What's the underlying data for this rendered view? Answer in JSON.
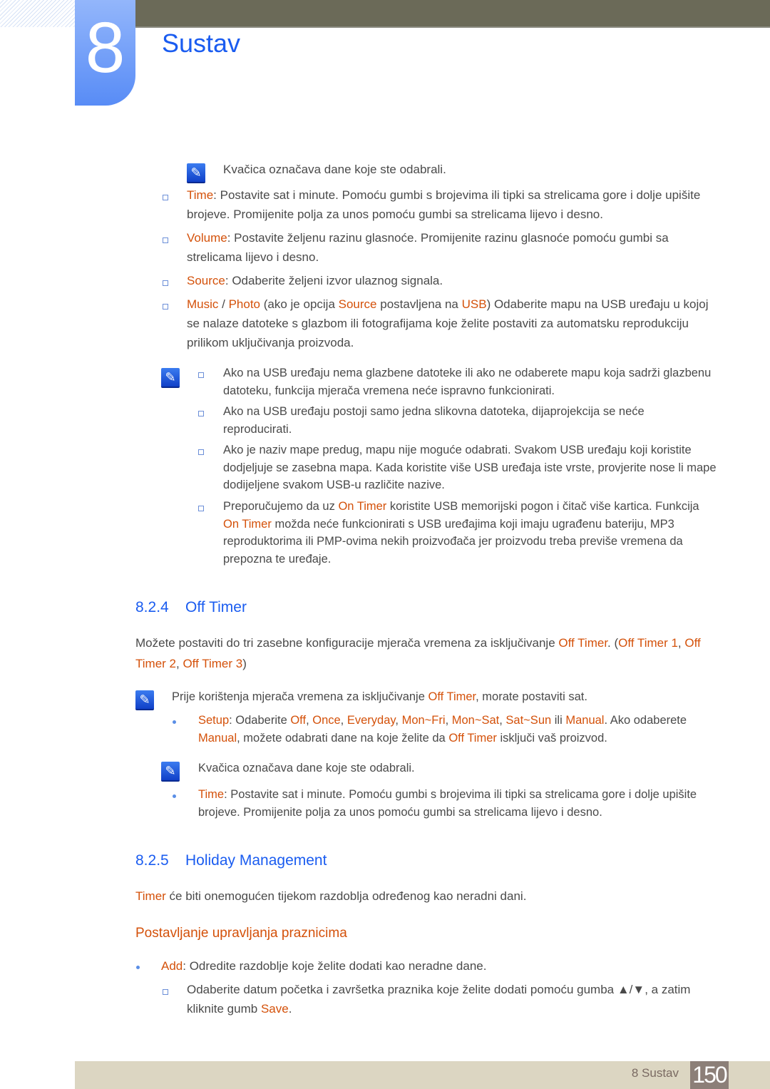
{
  "header": {
    "chapter_number": "8",
    "chapter_title": "Sustav"
  },
  "blocks": [
    {
      "parts": [
        [
          "Kvačica označava dane koje ste odabrali.",
          0
        ]
      ]
    },
    {
      "parts": [
        [
          "Time",
          1
        ],
        [
          ": Postavite sat i minute. Pomoću gumbi s brojevima ili tipki sa strelicama gore i dolje upišite brojeve. Promijenite polja za unos pomoću gumbi sa strelicama lijevo i desno.",
          0
        ]
      ]
    },
    {
      "parts": [
        [
          "Volume",
          1
        ],
        [
          ": Postavite željenu razinu glasnoće. Promijenite razinu glasnoće pomoću gumbi sa strelicama lijevo i desno.",
          0
        ]
      ]
    },
    {
      "parts": [
        [
          "Source",
          1
        ],
        [
          ": Odaberite željeni izvor ulaznog signala.",
          0
        ]
      ]
    },
    {
      "parts": [
        [
          "Music",
          1
        ],
        [
          " / ",
          0
        ],
        [
          "Photo",
          1
        ],
        [
          " (ako je opcija ",
          0
        ],
        [
          "Source",
          1
        ],
        [
          " postavljena na ",
          0
        ],
        [
          "USB",
          1
        ],
        [
          ") Odaberite mapu na USB uređaju u kojoj se nalaze datoteke s glazbom ili fotografijama koje želite postaviti za automatsku reprodukciju prilikom uključivanja proizvoda.",
          0
        ]
      ]
    },
    {
      "parts": [
        [
          "Ako na USB uređaju nema glazbene datoteke ili ako ne odaberete mapu koja sadrži glazbenu datoteku, funkcija mjerača vremena neće ispravno funkcionirati.",
          0
        ]
      ]
    },
    {
      "parts": [
        [
          "Ako na USB uređaju postoji samo jedna slikovna datoteka, dijaprojekcija se neće reproducirati.",
          0
        ]
      ]
    },
    {
      "parts": [
        [
          "Ako je naziv mape predug, mapu nije moguće odabrati. Svakom USB uređaju koji koristite dodjeljuje se zasebna mapa. Kada koristite više USB uređaja iste vrste, provjerite nose li mape dodijeljene svakom USB-u različite nazive.",
          0
        ]
      ]
    },
    {
      "parts": [
        [
          "Preporučujemo da uz ",
          0
        ],
        [
          "On Timer",
          1
        ],
        [
          " koristite USB memorijski pogon i čitač više kartica. Funkcija ",
          0
        ],
        [
          "On Timer",
          1
        ],
        [
          " možda neće funkcionirati s USB uređajima koji imaju ugrađenu bateriju, MP3 reproduktorima ili PMP-ovima nekih proizvođača jer proizvodu treba previše vremena da prepozna te uređaje.",
          0
        ]
      ]
    },
    {
      "parts": [
        [
          "Možete postaviti do tri zasebne konfiguracije mjerača vremena za isključivanje ",
          0
        ],
        [
          "Off Timer",
          1
        ],
        [
          ". (",
          0
        ],
        [
          "Off Timer 1",
          1
        ],
        [
          ", ",
          0
        ],
        [
          "Off Timer 2",
          1
        ],
        [
          ", ",
          0
        ],
        [
          "Off Timer 3",
          1
        ],
        [
          ")",
          0
        ]
      ]
    },
    {
      "parts": [
        [
          "Prije korištenja mjerača vremena za isključivanje ",
          0
        ],
        [
          "Off Timer",
          1
        ],
        [
          ", morate postaviti sat.",
          0
        ]
      ]
    },
    {
      "parts": [
        [
          "Setup",
          1
        ],
        [
          ": Odaberite ",
          0
        ],
        [
          "Off",
          1
        ],
        [
          ", ",
          0
        ],
        [
          "Once",
          1
        ],
        [
          ", ",
          0
        ],
        [
          "Everyday",
          1
        ],
        [
          ", ",
          0
        ],
        [
          "Mon~Fri",
          1
        ],
        [
          ", ",
          0
        ],
        [
          "Mon~Sat",
          1
        ],
        [
          ", ",
          0
        ],
        [
          "Sat~Sun",
          1
        ],
        [
          " ili ",
          0
        ],
        [
          "Manual",
          1
        ],
        [
          ". Ako odaberete ",
          0
        ],
        [
          "Manual",
          1
        ],
        [
          ", možete odabrati dane na koje želite da ",
          0
        ],
        [
          "Off Timer",
          1
        ],
        [
          " isključi vaš proizvod.",
          0
        ]
      ]
    },
    {
      "parts": [
        [
          "Kvačica označava dane koje ste odabrali.",
          0
        ]
      ]
    },
    {
      "parts": [
        [
          "Time",
          1
        ],
        [
          ": Postavite sat i minute. Pomoću gumbi s brojevima ili tipki sa strelicama gore i dolje upišite brojeve. Promijenite polja za unos pomoću gumbi sa strelicama lijevo i desno.",
          0
        ]
      ]
    },
    {
      "parts": [
        [
          "Timer",
          1
        ],
        [
          " će biti onemogućen tijekom razdoblja određenog kao neradni dani.",
          0
        ]
      ]
    },
    {
      "parts": [
        [
          "Add",
          1
        ],
        [
          ": Odredite razdoblje koje želite dodati kao neradne dane.",
          0
        ]
      ]
    },
    {
      "parts": [
        [
          "Odaberite datum početka i završetka praznika koje želite dodati pomoću gumba ▲/▼, a zatim kliknite gumb ",
          0
        ],
        [
          "Save",
          1
        ],
        [
          ".",
          0
        ]
      ]
    }
  ],
  "sections": {
    "s824_num": "8.2.4",
    "s824_title": "Off Timer",
    "s825_num": "8.2.5",
    "s825_title": "Holiday Management",
    "subheading": "Postavljanje upravljanja praznicima"
  },
  "footer": {
    "label": "8 Sustav",
    "page": "150"
  },
  "colors": {
    "accent_blue": "#1a5cf0",
    "highlight_orange": "#d4510a",
    "topbar": "#6b6a58",
    "footer": "#dcd6c2"
  }
}
